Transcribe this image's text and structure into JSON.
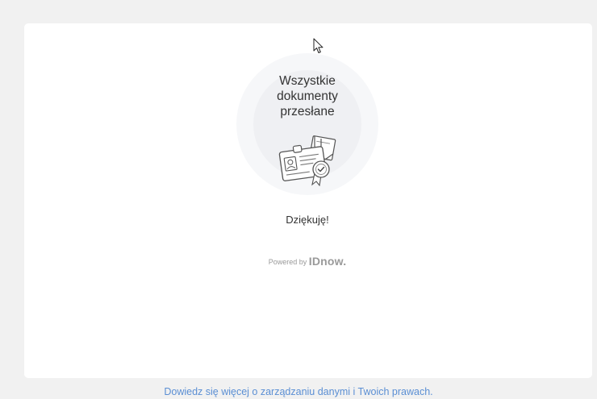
{
  "status": {
    "title": "Wszystkie\ndokumenty\nprzesłane",
    "thanks": "Dziękuję!"
  },
  "branding": {
    "powered_prefix": "Powered by",
    "brand_name": "IDnow."
  },
  "footer": {
    "link_text": "Dowiedz się więcej o zarządzaniu danymi i Twoich prawach."
  },
  "icons": {
    "cursor": "mouse-pointer-icon",
    "illustration": "documents-uploaded-icon"
  },
  "colors": {
    "background": "#f1f1f1",
    "card": "#ffffff",
    "link": "#5b8fd4",
    "text": "#333333",
    "muted": "#999999"
  }
}
